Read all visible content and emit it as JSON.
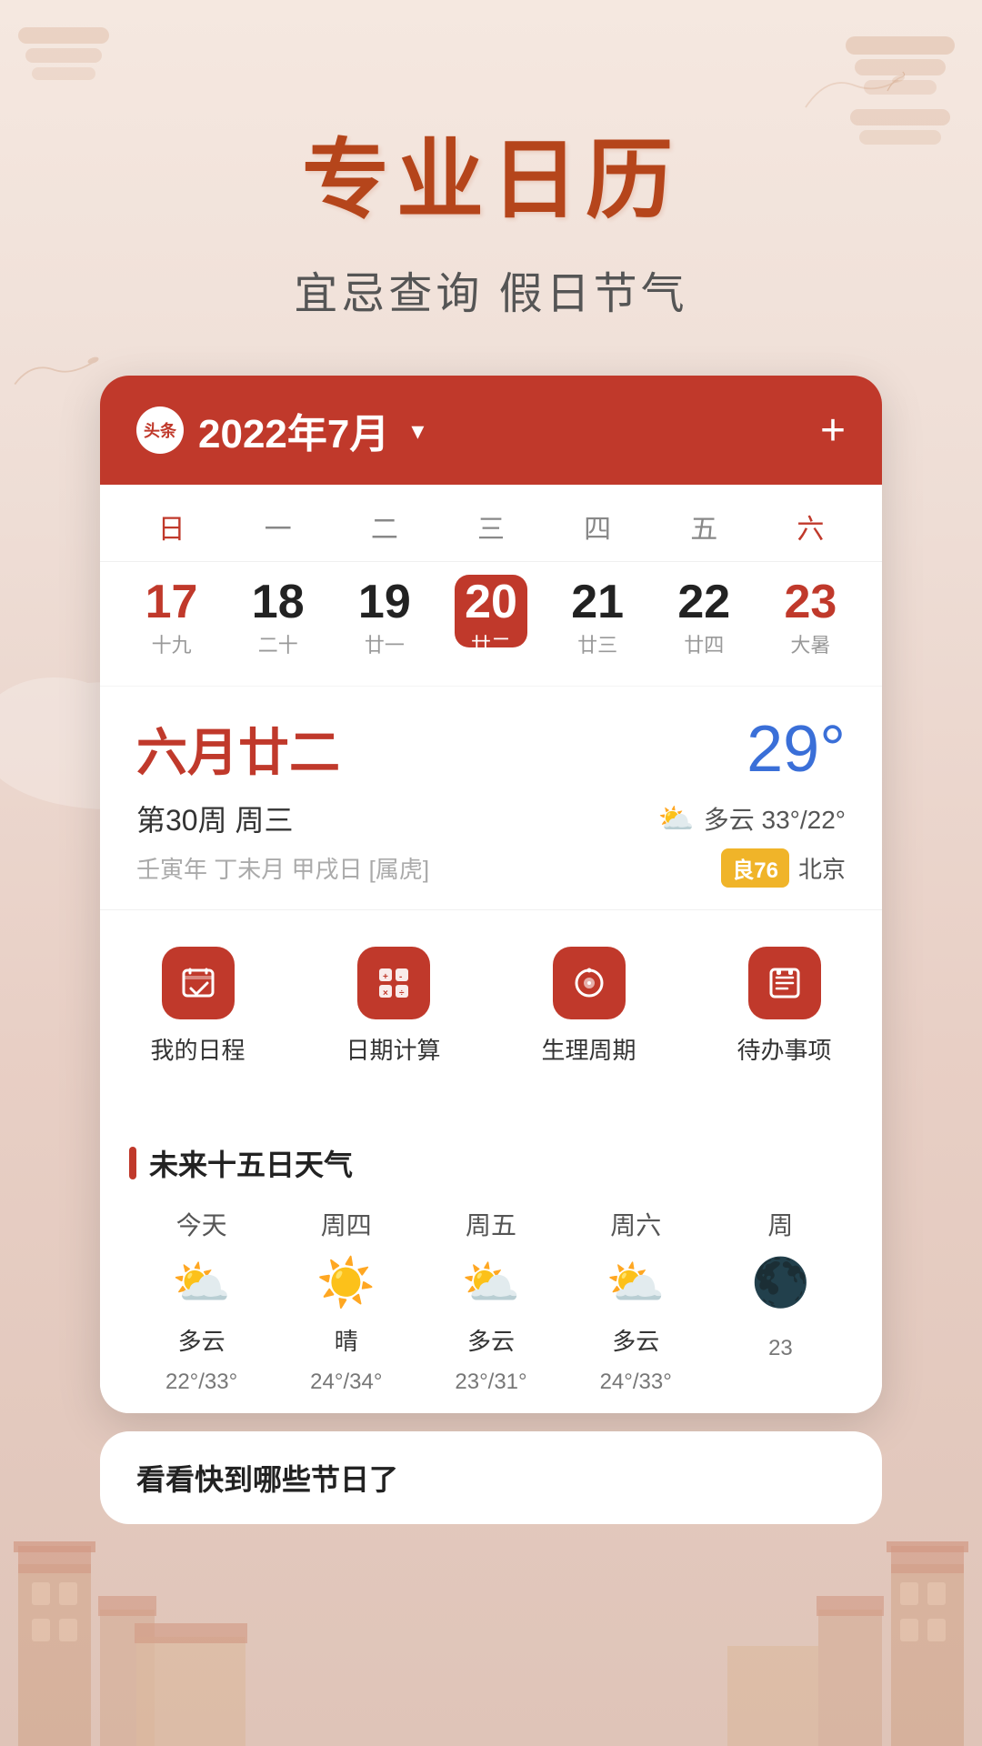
{
  "app": {
    "logo_text": "头条",
    "hero_title": "专业日历",
    "hero_subtitle": "宜忌查询 假日节气"
  },
  "calendar": {
    "month_label": "2022年7月",
    "add_btn": "+",
    "weekdays": [
      "日",
      "一",
      "二",
      "三",
      "四",
      "五",
      "六"
    ],
    "dates": [
      {
        "num": "17",
        "lunar": "十九",
        "is_red": true,
        "is_today": false
      },
      {
        "num": "18",
        "lunar": "二十",
        "is_red": false,
        "is_today": false
      },
      {
        "num": "19",
        "lunar": "廿一",
        "is_red": false,
        "is_today": false
      },
      {
        "num": "20",
        "lunar": "廿二",
        "is_red": false,
        "is_today": true
      },
      {
        "num": "21",
        "lunar": "廿三",
        "is_red": false,
        "is_today": false
      },
      {
        "num": "22",
        "lunar": "廿四",
        "is_red": false,
        "is_today": false
      },
      {
        "num": "23",
        "lunar": "大暑",
        "is_red": true,
        "is_today": false
      }
    ],
    "lunar_date_big": "六月廿二",
    "temperature": "29°",
    "week_info": "第30周  周三",
    "weather_desc": "多云 33°/22°",
    "ganzhi": "壬寅年 丁未月 甲戌日 [属虎]",
    "aqi_label": "良76",
    "city": "北京"
  },
  "quick_access": [
    {
      "icon": "✓",
      "label": "我的日程"
    },
    {
      "icon": "⊞",
      "label": "日期计算"
    },
    {
      "icon": "◎",
      "label": "生理周期"
    },
    {
      "icon": "📅",
      "label": "待办事项"
    }
  ],
  "weather_section": {
    "title": "未来十五日天气",
    "days": [
      {
        "label": "今天",
        "icon": "⛅",
        "desc": "多云",
        "temp": "22°/33°"
      },
      {
        "label": "周四",
        "icon": "☀️",
        "desc": "晴",
        "temp": "24°/34°"
      },
      {
        "label": "周五",
        "icon": "⛅",
        "desc": "多云",
        "temp": "23°/31°"
      },
      {
        "label": "周六",
        "icon": "⛅",
        "desc": "多云",
        "temp": "24°/33°"
      },
      {
        "label": "周",
        "icon": "🌑",
        "desc": "",
        "temp": "23"
      }
    ]
  },
  "bottom": {
    "title": "看看快到哪些节日了"
  }
}
